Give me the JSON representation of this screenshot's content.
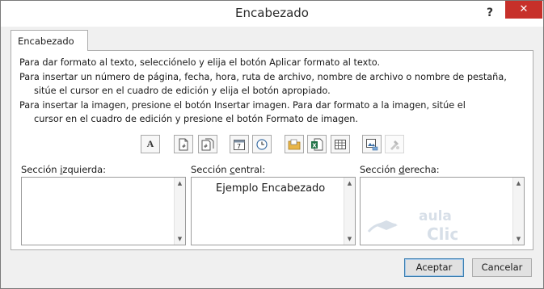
{
  "window": {
    "title": "Encabezado",
    "help_label": "?",
    "close_label": "✕"
  },
  "tab": {
    "label": "Encabezado"
  },
  "instructions": [
    "Para dar formato al texto, selecciónelo y elija el botón Aplicar formato al texto.",
    "Para insertar un número de página, fecha, hora, ruta de archivo, nombre de archivo o nombre de pestaña,",
    "sitúe el cursor en el cuadro de edición y elija el botón apropiado.",
    "Para insertar la imagen, presione el botón Insertar imagen. Para dar formato a la imagen, sitúe el",
    "cursor en el cuadro de edición y presione el botón Formato de imagen."
  ],
  "toolbar": {
    "format_text_label": "A",
    "icons": [
      "format-text-icon",
      "page-number-icon",
      "page-count-icon",
      "date-icon",
      "time-icon",
      "file-path-icon",
      "file-name-icon",
      "sheet-name-icon",
      "insert-picture-icon",
      "format-picture-icon"
    ],
    "date_digit": "7"
  },
  "sections": {
    "left": {
      "label_pre": "Sección ",
      "label_key": "i",
      "label_post": "zquierda:",
      "content": ""
    },
    "center": {
      "label_pre": "Sección ",
      "label_key": "c",
      "label_post": "entral:",
      "content": "Ejemplo Encabezado"
    },
    "right": {
      "label_pre": "Sección ",
      "label_key": "d",
      "label_post": "erecha:",
      "content": ""
    }
  },
  "watermark": {
    "text_top": "aula",
    "text_bottom": "Clic"
  },
  "buttons": {
    "accept": "Aceptar",
    "cancel": "Cancelar"
  },
  "colors": {
    "close_button": "#c7302a",
    "default_button_border": "#3c7fb1"
  }
}
